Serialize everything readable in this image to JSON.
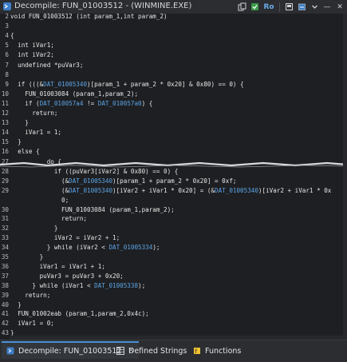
{
  "window": {
    "title": "Decompile: FUN_01003512 -  (WINMINE.EXE)"
  },
  "toolbar": {
    "icons": [
      "copy-icon",
      "refresh-icon",
      "ro-icon",
      "snapshot-icon",
      "export-icon",
      "menu-chevron-icon",
      "minimize-icon",
      "close-icon"
    ],
    "ro_label": "Ro",
    "minimize_label": "—",
    "close_label": "✕"
  },
  "code_lines": [
    {
      "n": "2",
      "segs": [
        {
          "t": "void FUN_01003512 (int param_1,int param_2)",
          "c": ""
        }
      ]
    },
    {
      "n": "3",
      "segs": []
    },
    {
      "n": "4",
      "segs": [
        {
          "t": "{",
          "c": ""
        }
      ]
    },
    {
      "n": "5",
      "segs": [
        {
          "t": "  int iVar1;",
          "c": ""
        }
      ]
    },
    {
      "n": "6",
      "segs": [
        {
          "t": "  int iVar2;",
          "c": ""
        }
      ]
    },
    {
      "n": "7",
      "segs": [
        {
          "t": "  undefined *puVar3;",
          "c": ""
        }
      ]
    },
    {
      "n": "8",
      "segs": []
    },
    {
      "n": "9",
      "segs": [
        {
          "t": "  if (((&",
          "c": ""
        },
        {
          "t": "DAT_01005340",
          "c": "glob"
        },
        {
          "t": ")[param_1 + param_2 * 0x20] & 0x80) == 0) {",
          "c": ""
        }
      ]
    },
    {
      "n": "10",
      "segs": [
        {
          "t": "    FUN_01003084 (param_1,param_2);",
          "c": ""
        }
      ]
    },
    {
      "n": "11",
      "segs": [
        {
          "t": "    if (",
          "c": ""
        },
        {
          "t": "DAT_010057a4",
          "c": "glob"
        },
        {
          "t": " != ",
          "c": ""
        },
        {
          "t": "DAT_010057a0",
          "c": "glob"
        },
        {
          "t": ") {",
          "c": ""
        }
      ]
    },
    {
      "n": "12",
      "segs": [
        {
          "t": "      return;",
          "c": ""
        }
      ]
    },
    {
      "n": "13",
      "segs": [
        {
          "t": "    }",
          "c": ""
        }
      ]
    },
    {
      "n": "14",
      "segs": [
        {
          "t": "    iVar1 = 1;",
          "c": ""
        }
      ]
    },
    {
      "n": "15",
      "segs": [
        {
          "t": "  }",
          "c": ""
        }
      ]
    },
    {
      "n": "16",
      "segs": [
        {
          "t": "  else {",
          "c": ""
        }
      ]
    }
  ],
  "code_lines_b": [
    {
      "n": "27",
      "segs": [
        {
          "t": "          do {",
          "c": ""
        }
      ]
    },
    {
      "n": "28",
      "segs": [
        {
          "t": "            if ((puVar3[iVar2] & 0x80) == 0) {",
          "c": ""
        }
      ]
    },
    {
      "n": "29",
      "segs": [
        {
          "t": "              (&",
          "c": ""
        },
        {
          "t": "DAT_01005340",
          "c": "glob"
        },
        {
          "t": ")[param_1 + param_2 * 0x20] = 0xf;",
          "c": ""
        }
      ]
    },
    {
      "n": "29",
      "segs": [
        {
          "t": "              (&",
          "c": ""
        },
        {
          "t": "DAT_01005340",
          "c": "glob"
        },
        {
          "t": ")[iVar2 + iVar1 * 0x20] = (&",
          "c": ""
        },
        {
          "t": "DAT_01005340",
          "c": "glob"
        },
        {
          "t": ")[iVar2 + iVar1 * 0x",
          "c": ""
        }
      ]
    },
    {
      "n": "",
      "segs": [
        {
          "t": "              0;",
          "c": ""
        }
      ]
    },
    {
      "n": "30",
      "segs": [
        {
          "t": "              FUN_01003084 (param_1,param_2);",
          "c": ""
        }
      ]
    },
    {
      "n": "31",
      "segs": [
        {
          "t": "              return;",
          "c": ""
        }
      ]
    },
    {
      "n": "32",
      "segs": [
        {
          "t": "            }",
          "c": ""
        }
      ]
    },
    {
      "n": "33",
      "segs": [
        {
          "t": "            iVar2 = iVar2 + 1;",
          "c": ""
        }
      ]
    },
    {
      "n": "34",
      "segs": [
        {
          "t": "          } while (iVar2 < ",
          "c": ""
        },
        {
          "t": "DAT_01005334",
          "c": "glob"
        },
        {
          "t": ");",
          "c": ""
        }
      ]
    },
    {
      "n": "35",
      "segs": [
        {
          "t": "        }",
          "c": ""
        }
      ]
    },
    {
      "n": "36",
      "segs": [
        {
          "t": "        iVar1 = iVar1 + 1;",
          "c": ""
        }
      ]
    },
    {
      "n": "37",
      "segs": [
        {
          "t": "        puVar3 = puVar3 + 0x20;",
          "c": ""
        }
      ]
    },
    {
      "n": "38",
      "segs": [
        {
          "t": "      } while (iVar1 < ",
          "c": ""
        },
        {
          "t": "DAT_01005338",
          "c": "glob"
        },
        {
          "t": ");",
          "c": ""
        }
      ]
    },
    {
      "n": "39",
      "segs": [
        {
          "t": "    return;",
          "c": ""
        }
      ]
    },
    {
      "n": "40",
      "segs": [
        {
          "t": "  }",
          "c": ""
        }
      ]
    },
    {
      "n": "41",
      "segs": [
        {
          "t": "  FUN_01002eab (param_1,param_2,0x4c);",
          "c": ""
        }
      ]
    },
    {
      "n": "42",
      "segs": [
        {
          "t": "  iVar1 = 0;",
          "c": ""
        }
      ]
    },
    {
      "n": "43",
      "segs": [
        {
          "t": "}",
          "c": ""
        }
      ]
    }
  ],
  "tabs": [
    {
      "label": "Decompile: FUN_01003512",
      "icon": "decompile-icon",
      "close": "✕",
      "active": true
    },
    {
      "label": "Defined Strings",
      "icon": "table-icon",
      "active": false
    },
    {
      "label": "Functions",
      "icon": "functions-icon",
      "active": false
    }
  ],
  "colors": {
    "global_label": "#5ba4e6",
    "background": "#1e1f22",
    "accent": "#4a90d9"
  }
}
